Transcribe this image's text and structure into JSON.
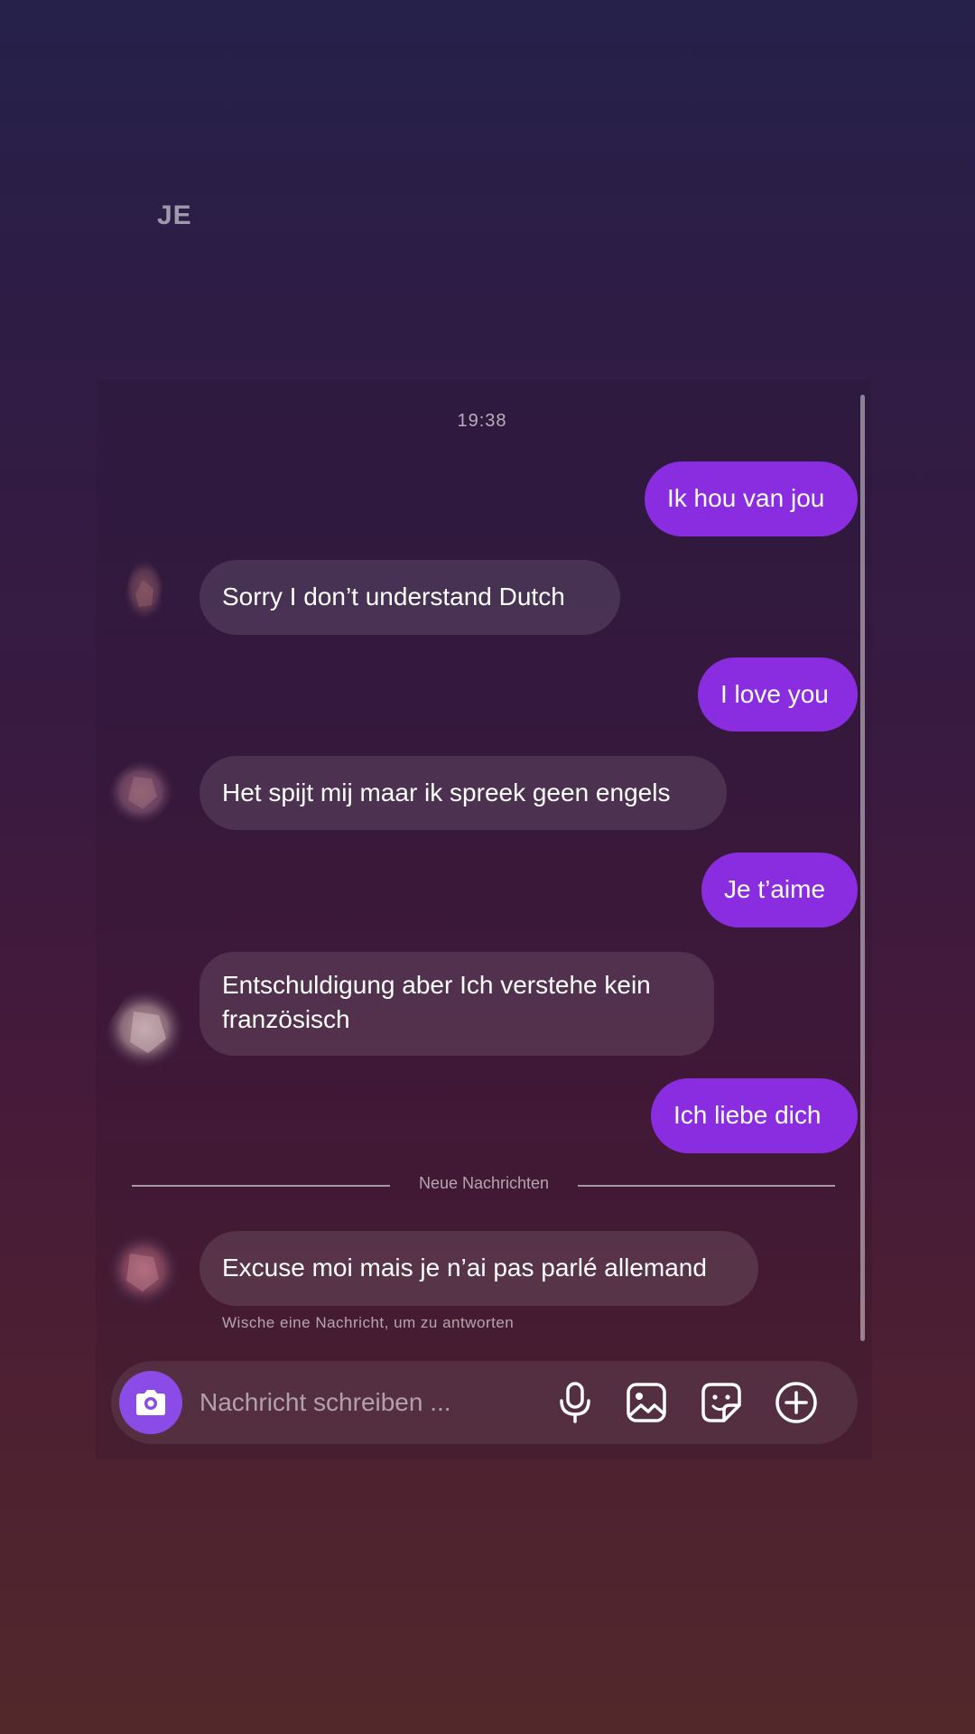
{
  "header": {
    "initials": "JE"
  },
  "chat": {
    "timestamp": "19:38",
    "messages": [
      {
        "direction": "out",
        "text": "Ik hou van jou"
      },
      {
        "direction": "in",
        "text": "Sorry I don’t understand Dutch"
      },
      {
        "direction": "out",
        "text": "I love you"
      },
      {
        "direction": "in",
        "text": "Het spijt mij maar ik spreek geen engels"
      },
      {
        "direction": "out",
        "text": "Je t’aime"
      },
      {
        "direction": "in",
        "text": "Entschuldigung aber Ich verstehe kein französisch"
      },
      {
        "direction": "out",
        "text": "Ich liebe dich"
      },
      {
        "direction": "in",
        "text": "Excuse moi mais je n’ai pas parlé allemand"
      }
    ],
    "new_messages_divider": "Neue Nachrichten",
    "swipe_hint": "Wische eine Nachricht, um zu antworten"
  },
  "composer": {
    "placeholder": "Nachricht schreiben ...",
    "value": "",
    "icons": {
      "camera": "camera-icon",
      "microphone": "microphone-icon",
      "gallery": "gallery-icon",
      "sticker": "sticker-icon",
      "more": "plus-circle-icon"
    }
  },
  "colors": {
    "outgoing_bubble": "#8a2ce0",
    "camera_button": "#8a4be6",
    "background_top": "#25214a",
    "background_bottom": "#52282a"
  }
}
